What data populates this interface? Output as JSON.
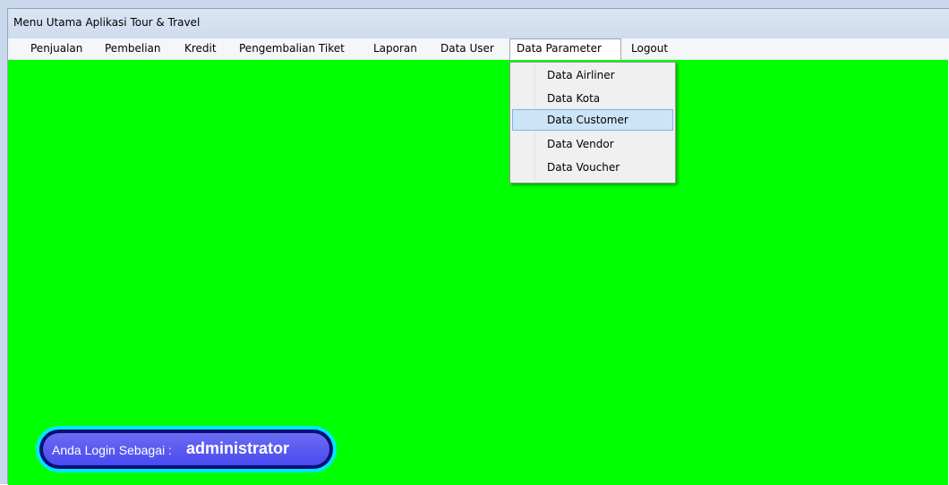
{
  "window": {
    "title": "Menu Utama Aplikasi Tour & Travel"
  },
  "menubar": {
    "items": [
      {
        "label": "Penjualan"
      },
      {
        "label": "Pembelian"
      },
      {
        "label": "Kredit"
      },
      {
        "label": "Pengembalian Tiket"
      },
      {
        "label": "Laporan"
      },
      {
        "label": "Data User"
      },
      {
        "label": "Data Parameter"
      },
      {
        "label": "Logout"
      }
    ],
    "active": "Data Parameter"
  },
  "dropdown": {
    "items": [
      {
        "label": "Data Airliner"
      },
      {
        "label": "Data Kota"
      },
      {
        "label": "Data Customer"
      },
      {
        "label": "Data Vendor"
      },
      {
        "label": "Data Voucher"
      }
    ],
    "highlighted": "Data Customer"
  },
  "status": {
    "login_label": "Anda Login Sebagai :",
    "username": "administrator"
  },
  "colors": {
    "background": "#00ff00",
    "badge_outer": "#00e6ff",
    "badge_inner": "#5a5af0",
    "highlight": "#cce4f7"
  }
}
